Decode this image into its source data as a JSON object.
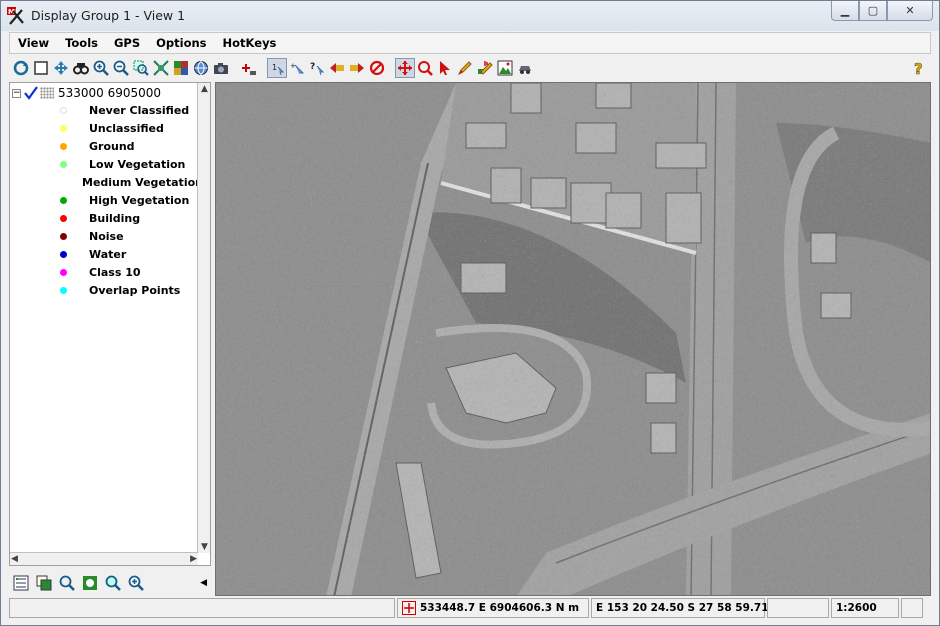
{
  "window": {
    "title": "Display Group 1 - View 1"
  },
  "menu": [
    "View",
    "Tools",
    "GPS",
    "Options",
    "HotKeys"
  ],
  "toolbar": {
    "tools": [
      "redraw-icon",
      "full-view-icon",
      "pan-view-icon",
      "binoculars-icon",
      "zoom-in-icon",
      "zoom-out-icon",
      "zoom-box-icon",
      "zoom-fit-icon",
      "layer-group-icon",
      "globe-icon",
      "camera-icon",
      "add-layer-icon",
      "select-one-icon",
      "select-multiple-icon",
      "query-icon",
      "previous-icon",
      "next-icon",
      "stop-icon",
      "move-tool-icon",
      "zoom-tool-icon",
      "pointer-tool-icon",
      "pencil-tool-icon",
      "edit-tool-icon",
      "image-tool-icon",
      "vehicle-tool-icon"
    ],
    "help": "help-icon"
  },
  "legend": {
    "layer_name": "533000 6905000",
    "classes": [
      {
        "label": "Never Classified",
        "color": "#ffffff"
      },
      {
        "label": "Unclassified",
        "color": "#ffff66"
      },
      {
        "label": "Ground",
        "color": "#ffa500"
      },
      {
        "label": "Low Vegetation",
        "color": "#80ff80"
      },
      {
        "label": "Medium Vegetation",
        "color": "#00ee00"
      },
      {
        "label": "High Vegetation",
        "color": "#00aa00"
      },
      {
        "label": "Building",
        "color": "#ff0000"
      },
      {
        "label": "Noise",
        "color": "#800000"
      },
      {
        "label": "Water",
        "color": "#0000cc"
      },
      {
        "label": "Class 10",
        "color": "#ff00ff"
      },
      {
        "label": "Overlap Points",
        "color": "#00ffff"
      }
    ]
  },
  "status": {
    "coords_utm": "533448.7 E  6904606.3 N m",
    "coords_geo": "E 153 20 24.50  S 27 58 59.71",
    "scale": "1:2600"
  }
}
